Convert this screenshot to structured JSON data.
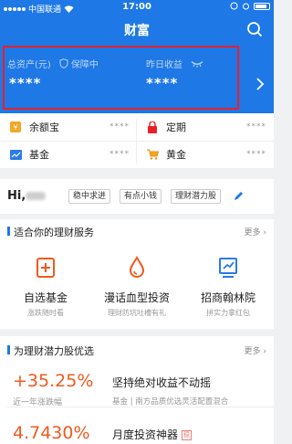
{
  "status_bar": {
    "carrier": "中国联通",
    "time": "17:00"
  },
  "nav": {
    "title": "财富"
  },
  "assets": {
    "total_label": "总资产(元)",
    "protect_label": "保障中",
    "total_value": "****",
    "yesterday_label": "昨日收益",
    "yesterday_value": "****"
  },
  "quick_grid": [
    {
      "label": "余额宝",
      "value": "****",
      "icon": "yuebao-icon"
    },
    {
      "label": "定期",
      "value": "****",
      "icon": "lock-icon"
    },
    {
      "label": "基金",
      "value": "****",
      "icon": "fund-chart-icon"
    },
    {
      "label": "黄金",
      "value": "****",
      "icon": "gold-cart-icon"
    }
  ],
  "greeting": {
    "hi": "Hi,",
    "tags": [
      "稳中求进",
      "有点小钱",
      "理财潜力股"
    ]
  },
  "services": {
    "title": "适合你的理财服务",
    "more": "更多",
    "items": [
      {
        "name": "自选基金",
        "desc": "涨跌随时看",
        "icon": "plus-doc-icon"
      },
      {
        "name": "漫话血型投资",
        "desc": "理财防坑吐槽有礼",
        "icon": "blood-drop-icon"
      },
      {
        "name": "招商翰林院",
        "desc": "拼实力拿红包",
        "icon": "chart-board-icon"
      }
    ]
  },
  "potential": {
    "title": "为理财潜力股优选",
    "more": "更多",
    "items": [
      {
        "value": "+35.25%",
        "sub": "近一年涨跌幅",
        "title": "坚持绝对收益不动摇",
        "desc": "基金 | 南方品质优选灵活配置混合"
      },
      {
        "value": "4.7430%",
        "title": "月度投资神器",
        "badge": "稳"
      }
    ]
  },
  "colors": {
    "accent": "#1e78e6",
    "highlight": "#e8202a",
    "gain": "#f05a1e"
  }
}
